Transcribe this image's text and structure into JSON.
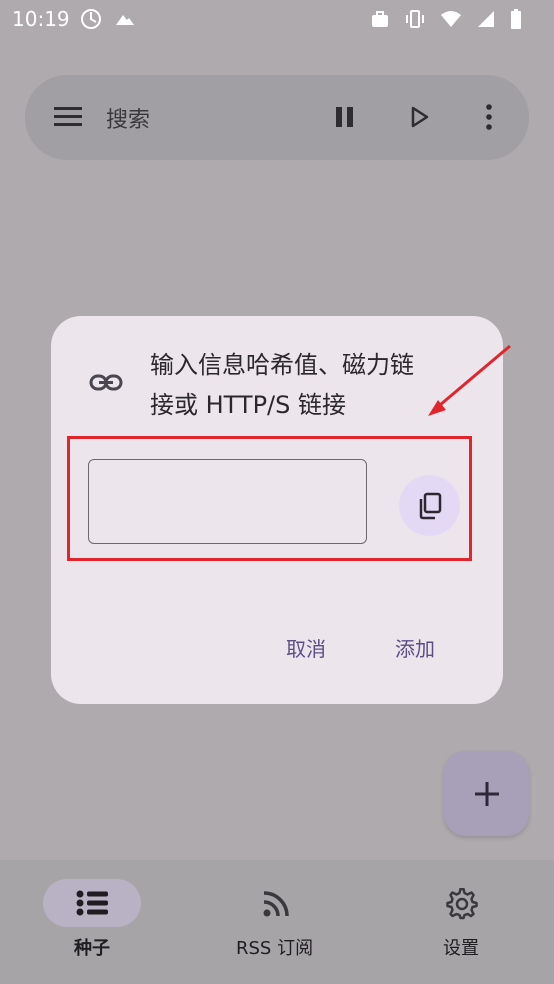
{
  "status_bar": {
    "time": "10:19",
    "icons_left": [
      "app-icon",
      "mountain-icon"
    ],
    "icons_right": [
      "briefcase-icon",
      "vibrate-icon",
      "wifi-icon",
      "signal-icon",
      "battery-icon"
    ]
  },
  "search_bar": {
    "label": "搜索",
    "icons": [
      "menu-icon",
      "pause-icon",
      "play-icon",
      "more-vert-icon"
    ]
  },
  "dialog": {
    "title": "输入信息哈希值、磁力链接或 HTTP/S 链接",
    "title_line1": "输入信息哈希值、磁力链",
    "title_line2": "接或 HTTP/S 链接",
    "input_value": "",
    "cancel_label": "取消",
    "add_label": "添加"
  },
  "fab": {
    "icon": "plus-icon"
  },
  "bottom_nav": {
    "items": [
      {
        "label": "种子",
        "icon": "list-icon",
        "selected": true
      },
      {
        "label": "RSS 订阅",
        "icon": "rss-icon",
        "selected": false
      },
      {
        "label": "设置",
        "icon": "gear-icon",
        "selected": false
      }
    ]
  },
  "colors": {
    "background": "#aeaaae",
    "dialog": "#ece6ec",
    "accent": "#5b4d86",
    "highlight": "#e0262c"
  }
}
